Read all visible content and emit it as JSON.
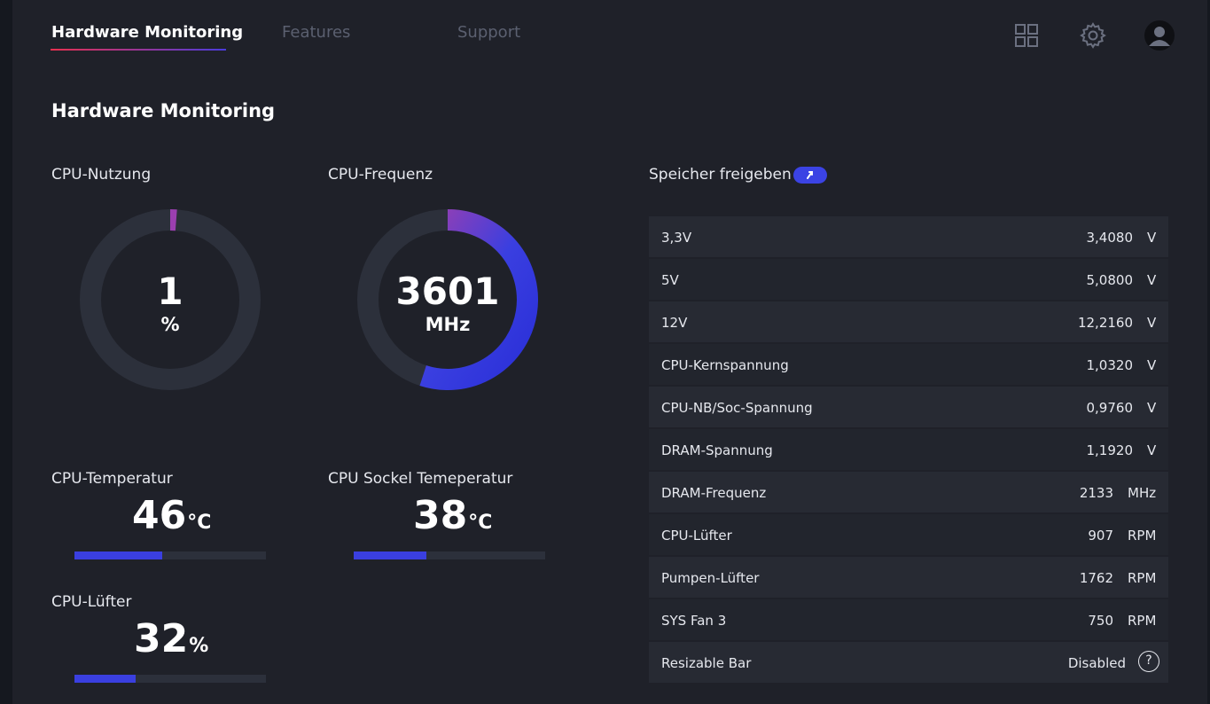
{
  "nav": {
    "tabs": [
      {
        "label": "Hardware Monitoring"
      },
      {
        "label": "Features"
      },
      {
        "label": "Support"
      }
    ]
  },
  "icons": {
    "grid": "grid-icon",
    "settings": "gear-icon",
    "user": "avatar-icon"
  },
  "page_title": "Hardware Monitoring",
  "cpu_usage": {
    "label": "CPU-Nutzung",
    "value": "1",
    "unit": "%",
    "fraction": 0.01
  },
  "cpu_freq": {
    "label": "CPU-Frequenz",
    "value": "3601",
    "unit": "MHz",
    "fraction": 0.55
  },
  "cpu_temp": {
    "label": "CPU-Temperatur",
    "value": "46",
    "unit": "°C",
    "fraction": 0.46
  },
  "socket_temp": {
    "label": "CPU Sockel Temeperatur",
    "value": "38",
    "unit": "°C",
    "fraction": 0.38
  },
  "cpu_fan": {
    "label": "CPU-Lüfter",
    "value": "32",
    "unit": "%",
    "fraction": 0.32
  },
  "memory": {
    "label": "Speicher freigeben"
  },
  "sensors": [
    {
      "name": "3,3V",
      "value": "3,4080",
      "unit": "V"
    },
    {
      "name": "5V",
      "value": "5,0800",
      "unit": "V"
    },
    {
      "name": "12V",
      "value": "12,2160",
      "unit": "V"
    },
    {
      "name": "CPU-Kernspannung",
      "value": "1,0320",
      "unit": "V"
    },
    {
      "name": "CPU-NB/Soc-Spannung",
      "value": "0,9760",
      "unit": "V"
    },
    {
      "name": "DRAM-Spannung",
      "value": "1,1920",
      "unit": "V"
    },
    {
      "name": "DRAM-Frequenz",
      "value": "2133",
      "unit": "MHz"
    },
    {
      "name": "CPU-Lüfter",
      "value": "907",
      "unit": "RPM"
    },
    {
      "name": "Pumpen-Lüfter",
      "value": "1762",
      "unit": "RPM"
    },
    {
      "name": "SYS Fan 3",
      "value": "750",
      "unit": "RPM"
    }
  ],
  "resizable_bar": {
    "name": "Resizable Bar",
    "value": "Disabled",
    "help": "?"
  },
  "colors": {
    "accent": "#3a3fe0",
    "gauge_start": "#9b3fb0",
    "gauge_end": "#2a2fd8",
    "track": "#2c303b"
  }
}
